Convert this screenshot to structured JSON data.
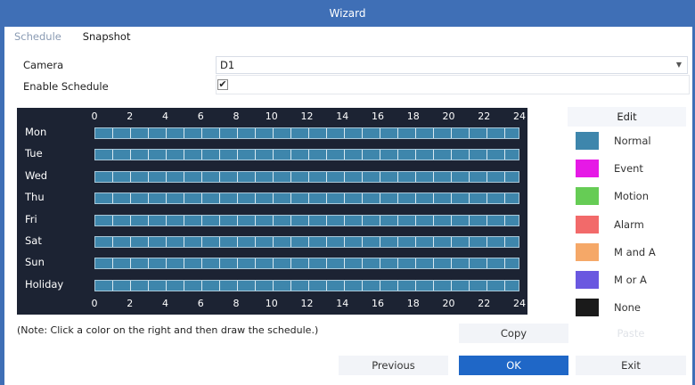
{
  "window": {
    "title": "Wizard"
  },
  "tabs": [
    {
      "label": "Schedule",
      "active": false
    },
    {
      "label": "Snapshot",
      "active": true
    }
  ],
  "form": {
    "camera_label": "Camera",
    "camera_value": "D1",
    "enable_label": "Enable Schedule",
    "enable_checked": true,
    "check_glyph": "✔"
  },
  "schedule": {
    "hours": [
      "0",
      "2",
      "4",
      "6",
      "8",
      "10",
      "12",
      "14",
      "16",
      "18",
      "20",
      "22",
      "24"
    ],
    "days": [
      "Mon",
      "Tue",
      "Wed",
      "Thu",
      "Fri",
      "Sat",
      "Sun",
      "Holiday"
    ],
    "fill_color": "#3e86ac",
    "fill_mode": "Normal",
    "coverage_fraction": 1.0
  },
  "legend": {
    "edit_label": "Edit",
    "items": [
      {
        "label": "Normal",
        "color": "#3e86ac"
      },
      {
        "label": "Event",
        "color": "#e619e6"
      },
      {
        "label": "Motion",
        "color": "#66cc55"
      },
      {
        "label": "Alarm",
        "color": "#f26a6a"
      },
      {
        "label": "M and A",
        "color": "#f5a868"
      },
      {
        "label": "M or A",
        "color": "#6a58e0"
      },
      {
        "label": "None",
        "color": "#1a1a1a"
      }
    ]
  },
  "note": "(Note: Click a color on the right and then draw the schedule.)",
  "buttons": {
    "copy": "Copy",
    "paste": "Paste",
    "previous": "Previous",
    "ok": "OK",
    "exit": "Exit"
  }
}
